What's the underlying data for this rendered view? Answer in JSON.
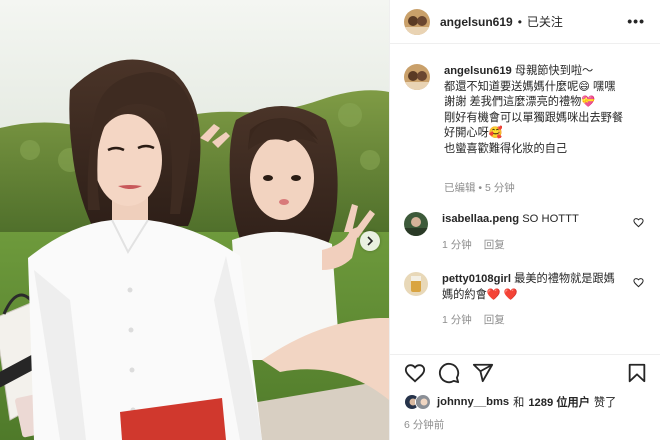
{
  "post": {
    "username": "angelsun619",
    "follow_status": "已关注",
    "more_glyph": "•••",
    "photo": {
      "bag_text": "CHRISTIAN"
    }
  },
  "caption": {
    "username": "angelsun619",
    "lines": [
      "母親節快到啦～",
      "都還不知道要送媽媽什麼呢😄 嘿嘿",
      "謝謝        差我們這麼漂亮的禮物💝",
      "剛好有機會可以單獨跟媽咪出去野餐",
      "好開心呀🥰",
      "也蠻喜歡難得化妝的自己"
    ],
    "edited": "已编辑",
    "age": "5 分钟"
  },
  "comments": [
    {
      "username": "isabellaa.peng",
      "text": "SO HOTTT",
      "age": "1 分钟",
      "reply": "回复"
    },
    {
      "username": "petty0108girl",
      "text": "最美的禮物就是跟媽媽的約會❤️ ❤️",
      "age": "1 分钟",
      "reply": "回复"
    }
  ],
  "actions": {
    "icons": [
      "heart-icon",
      "comment-icon",
      "share-icon",
      "bookmark-icon"
    ]
  },
  "likes": {
    "first_user": "johnny__bms",
    "joiner": "和",
    "count_text": "1289 位用户",
    "suffix": "赞了"
  },
  "timestamp": "6 分钟前"
}
